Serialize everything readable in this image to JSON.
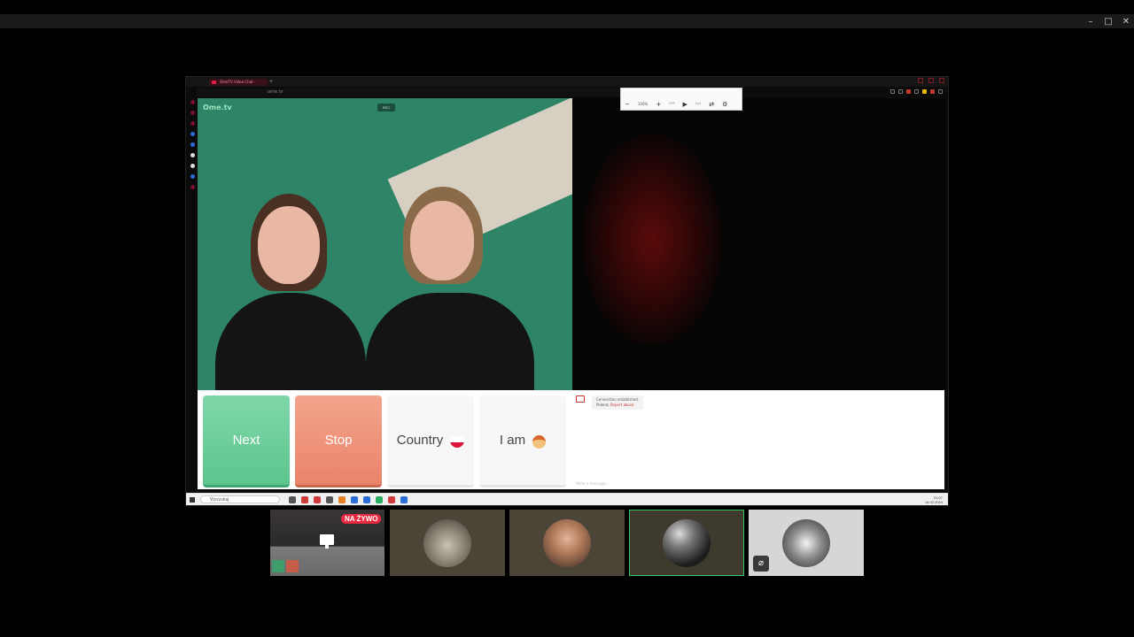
{
  "window": {
    "minimize_glyph": "–",
    "maximize_glyph": "□",
    "close_glyph": "✕"
  },
  "browser": {
    "tab_title": "OmeTV Video Chat -",
    "address": "ome.tv",
    "add_tab_glyph": "+"
  },
  "video": {
    "logo_text": "Ome.tv",
    "cam_badge": "REC"
  },
  "pdf_toolbar": {
    "zoom": "100%",
    "minus": "−",
    "plus": "+",
    "play": "▶"
  },
  "controls": {
    "next_label": "Next",
    "stop_label": "Stop",
    "country_label": "Country",
    "iam_label": "I am"
  },
  "chat": {
    "system_message": "Connection established.",
    "location_prefix": "Poland,",
    "location_link": "Report abuse",
    "input_placeholder": "Write a message..."
  },
  "taskbar": {
    "search_placeholder": "Wyszukaj",
    "time": "21:07",
    "date": "14.02.2024"
  },
  "participants": [
    {
      "name": "screen-share",
      "live_badge": "NA ŻYWO"
    },
    {
      "name": "cat"
    },
    {
      "name": "boy"
    },
    {
      "name": "ball"
    },
    {
      "name": "bodybuilder",
      "icon": "no-screenshare-icon"
    }
  ],
  "colors": {
    "next_green": "#5cc58e",
    "stop_salmon": "#e9846a",
    "live_red": "#e8293f",
    "active_border": "#36c36a"
  }
}
